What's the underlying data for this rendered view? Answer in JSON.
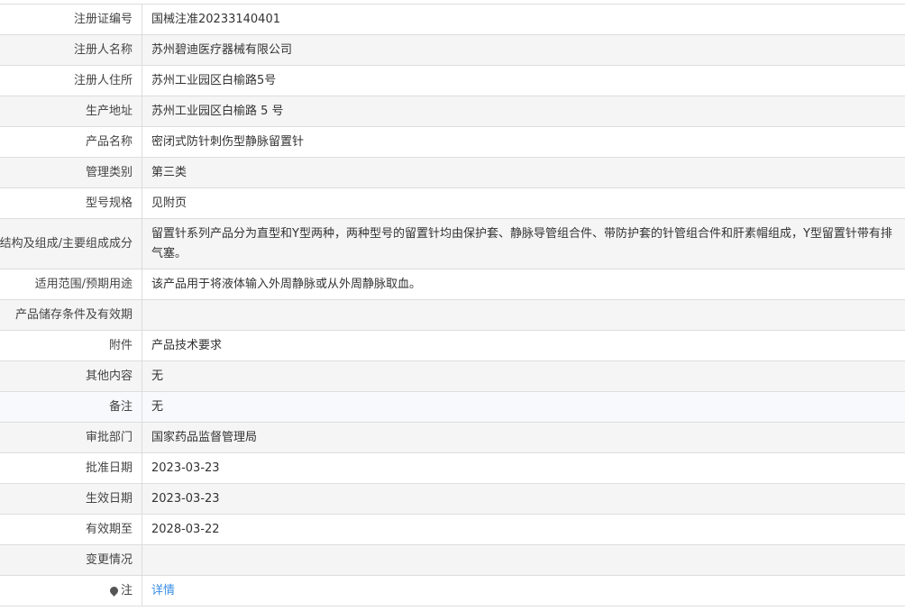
{
  "rows": [
    {
      "label": "注册证编号",
      "value": "国械注准20233140401"
    },
    {
      "label": "注册人名称",
      "value": "苏州碧迪医疗器械有限公司"
    },
    {
      "label": "注册人住所",
      "value": "苏州工业园区白榆路5号"
    },
    {
      "label": "生产地址",
      "value": "苏州工业园区白榆路 5 号"
    },
    {
      "label": "产品名称",
      "value": "密闭式防针刺伤型静脉留置针"
    },
    {
      "label": "管理类别",
      "value": "第三类"
    },
    {
      "label": "型号规格",
      "value": "见附页"
    },
    {
      "label": "结构及组成/主要组成成分",
      "value": "留置针系列产品分为直型和Y型两种，两种型号的留置针均由保护套、静脉导管组合件、带防护套的针管组合件和肝素帽组成，Y型留置针带有排气塞。"
    },
    {
      "label": "适用范围/预期用途",
      "value": "该产品用于将液体输入外周静脉或从外周静脉取血。"
    },
    {
      "label": "产品储存条件及有效期",
      "value": ""
    },
    {
      "label": "附件",
      "value": "产品技术要求"
    },
    {
      "label": "其他内容",
      "value": "无"
    },
    {
      "label": "备注",
      "value": "无"
    },
    {
      "label": "审批部门",
      "value": "国家药品监督管理局"
    },
    {
      "label": "批准日期",
      "value": "2023-03-23"
    },
    {
      "label": "生效日期",
      "value": "2023-03-23"
    },
    {
      "label": "有效期至",
      "value": "2028-03-22"
    },
    {
      "label": "变更情况",
      "value": ""
    }
  ],
  "note": {
    "label": "注",
    "link": "详情",
    "icon": "pin-icon"
  }
}
